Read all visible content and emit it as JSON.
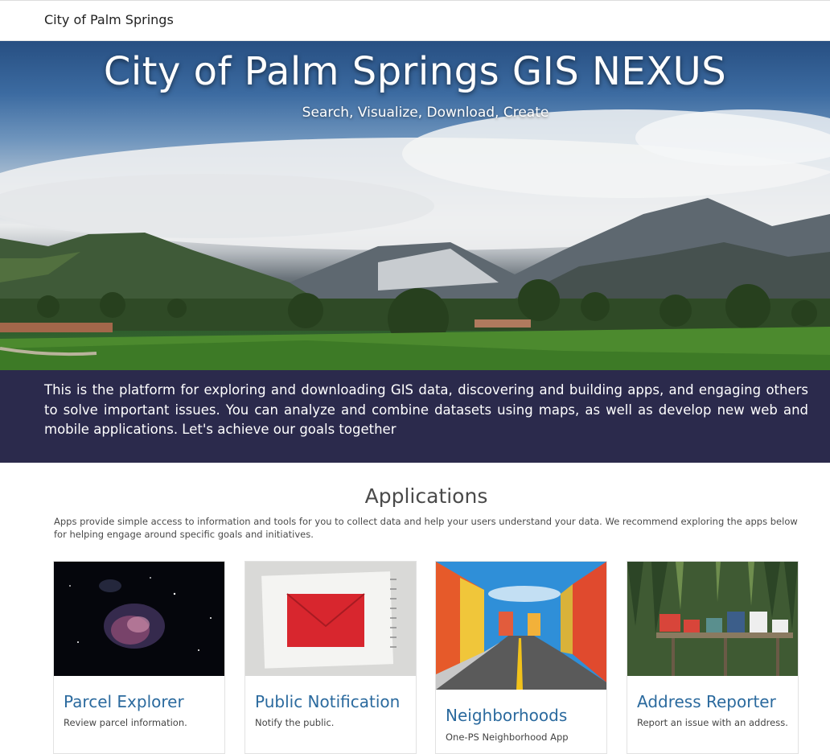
{
  "header": {
    "site_name": "City of Palm Springs"
  },
  "hero": {
    "title": "City of Palm Springs GIS NEXUS",
    "subtitle": "Search, Visualize, Download, Create"
  },
  "intro": {
    "text": "This is the platform for exploring and downloading GIS data, discovering and building apps, and engaging others to solve important issues. You can analyze and combine datasets using maps, as well as develop new web and mobile applications. Let's achieve our goals together"
  },
  "applications": {
    "title": "Applications",
    "description": "Apps provide simple access to information and tools for you to collect data and help your users understand your data. We recommend exploring the apps below for helping engage around specific goals and initiatives.",
    "cards": [
      {
        "title": "Parcel Explorer",
        "description": "Review parcel information.",
        "image": "nebula-image"
      },
      {
        "title": "Public Notification",
        "description": "Notify the public.",
        "image": "red-envelope-image"
      },
      {
        "title": "Neighborhoods",
        "description": "One-PS Neighborhood App",
        "image": "colorful-street-image"
      },
      {
        "title": "Address Reporter",
        "description": "Report an issue with an address.",
        "image": "mailboxes-image"
      }
    ]
  },
  "colors": {
    "intro_band": "#2b2a4c",
    "card_title": "#2b6a9e",
    "section_title": "#4a4a4a"
  }
}
